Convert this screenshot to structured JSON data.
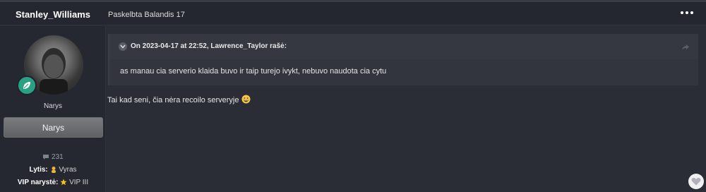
{
  "post": {
    "author": "Stanley_Williams",
    "posted_label": "Paskelbta Balandis 17",
    "more_icon": "ellipsis-icon"
  },
  "sidebar": {
    "rank": "Narys",
    "group": "Narys",
    "post_count": "231",
    "gender_label": "Lytis:",
    "gender_value": "Vyras",
    "vip_label": "VIP narystė:",
    "vip_value": "VIP III",
    "badge_icon": "leaf-icon"
  },
  "quote": {
    "citation": "On 2023-04-17 at 22:52, Lawrence_Taylor rašė:",
    "text": "as manau cia serverio klaida buvo ir taip turejo ivykt, nebuvo naudota cia cytu"
  },
  "body_text": "Tai kad seni, čia nėra recoilo serveryje",
  "colors": {
    "background": "#2b2d36",
    "badge": "#2aa182",
    "group_banner": "#6c6e72"
  }
}
